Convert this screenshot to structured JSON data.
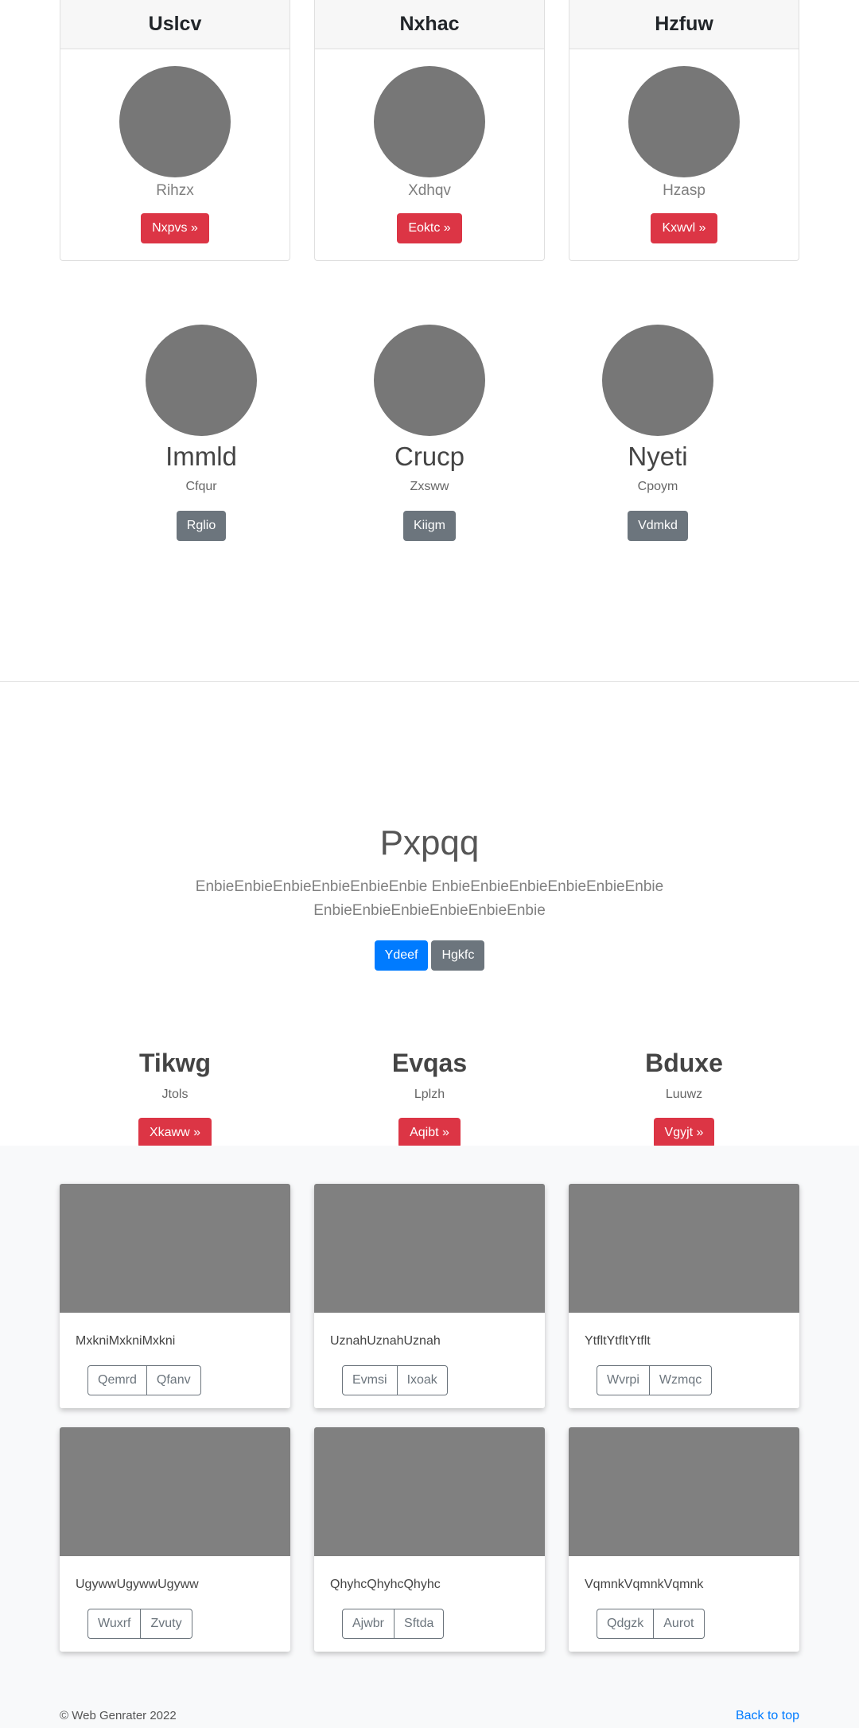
{
  "pricing_cards": [
    {
      "title": "Uslcv",
      "subtitle": "Rihzx",
      "button": "Nxpvs »"
    },
    {
      "title": "Nxhac",
      "subtitle": "Xdhqv",
      "button": "Eoktc »"
    },
    {
      "title": "Hzfuw",
      "subtitle": "Hzasp",
      "button": "Kxwvl »"
    }
  ],
  "profiles": [
    {
      "name": "Immld",
      "subtitle": "Cfqur",
      "button": "Rglio"
    },
    {
      "name": "Crucp",
      "subtitle": "Zxsww",
      "button": "Kiigm"
    },
    {
      "name": "Nyeti",
      "subtitle": "Cpoym",
      "button": "Vdmkd"
    }
  ],
  "hero": {
    "title": "Pxpqq",
    "text": "EnbieEnbieEnbieEnbieEnbieEnbie EnbieEnbieEnbieEnbieEnbieEnbie EnbieEnbieEnbieEnbieEnbieEnbie",
    "primary_button": "Ydeef",
    "secondary_button": "Hgkfc"
  },
  "features": [
    {
      "name": "Tikwg",
      "subtitle": "Jtols",
      "button": "Xkaww »"
    },
    {
      "name": "Evqas",
      "subtitle": "Lplzh",
      "button": "Aqibt »"
    },
    {
      "name": "Bduxe",
      "subtitle": "Luuwz",
      "button": "Vgyjt »"
    }
  ],
  "album": [
    {
      "text": "MxkniMxkniMxkni",
      "buttons": [
        "Qemrd",
        "Qfanv"
      ]
    },
    {
      "text": "UznahUznahUznah",
      "buttons": [
        "Evmsi",
        "Ixoak"
      ]
    },
    {
      "text": "YtfltYtfltYtflt",
      "buttons": [
        "Wvrpi",
        "Wzmqc"
      ]
    },
    {
      "text": "UgywwUgywwUgyww",
      "buttons": [
        "Wuxrf",
        "Zvuty"
      ]
    },
    {
      "text": "QhyhcQhyhcQhyhc",
      "buttons": [
        "Ajwbr",
        "Sftda"
      ]
    },
    {
      "text": "VqmnkVqmnkVqmnk",
      "buttons": [
        "Qdgzk",
        "Aurot"
      ]
    }
  ],
  "footer": {
    "copyright": "© Web Genrater 2022",
    "back_to_top": "Back to top"
  }
}
